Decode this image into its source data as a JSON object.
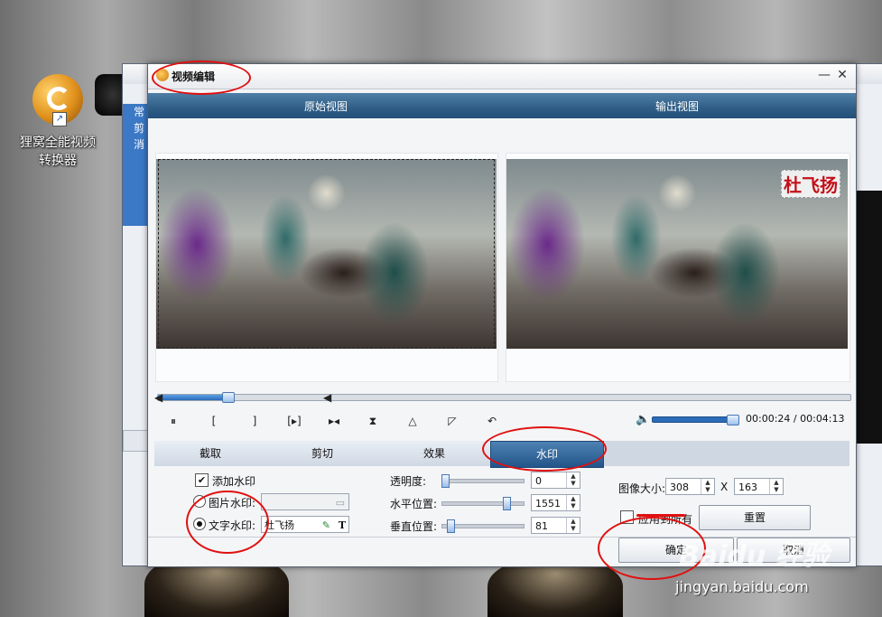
{
  "desktop": {
    "shortcut_label": "狸窝全能视频转换器",
    "shortcut_arrow": "↗"
  },
  "background_window": {
    "side_labels": [
      "常",
      "剪",
      "消"
    ]
  },
  "dialog": {
    "title": "视频编辑",
    "minimize": "—",
    "close": "✕",
    "original_view_label": "原始视图",
    "output_view_label": "输出视图",
    "watermark_preview_text": "杜飞扬"
  },
  "timeline": {
    "start_marker": "◀",
    "end_marker": "◀",
    "progress": 0.1,
    "volume": 1.0,
    "current_time": "00:00:24",
    "separator": " / ",
    "total_time": "00:04:13",
    "controls": [
      "⏸",
      "[",
      "]",
      "[▸]",
      "▸◂",
      "⧗",
      "△",
      "◸",
      "↶"
    ],
    "volume_icon": "🔈"
  },
  "tabs": [
    {
      "label": "截取",
      "active": false
    },
    {
      "label": "剪切",
      "active": false
    },
    {
      "label": "效果",
      "active": false
    },
    {
      "label": "水印",
      "active": true
    }
  ],
  "watermark_panel": {
    "add_watermark_label": "添加水印",
    "add_watermark_checked": "✔",
    "image_watermark_label": "图片水印:",
    "text_watermark_label": "文字水印:",
    "text_watermark_value": "杜飞扬",
    "text_icon": "T",
    "pen_icon": "✎",
    "folder_icon": "▭",
    "transparency_label": "透明度:",
    "transparency_value": "0",
    "horizontal_label": "水平位置:",
    "horizontal_value": "1551",
    "vertical_label": "垂直位置:",
    "vertical_value": "81",
    "image_size_label": "图像大小:",
    "width_value": "308",
    "size_sep": "X",
    "height_value": "163",
    "apply_all_label": "应用到所有",
    "reset_label": "重置"
  },
  "footer": {
    "ok_label": "确定",
    "cancel_label": "取消"
  },
  "watermark": {
    "brand": "Baidu 经验",
    "url": "jingyan.baidu.com"
  },
  "colors": {
    "accent": "#2b6cb8",
    "annotation": "#e01010",
    "watermark_text": "#c4111b"
  }
}
